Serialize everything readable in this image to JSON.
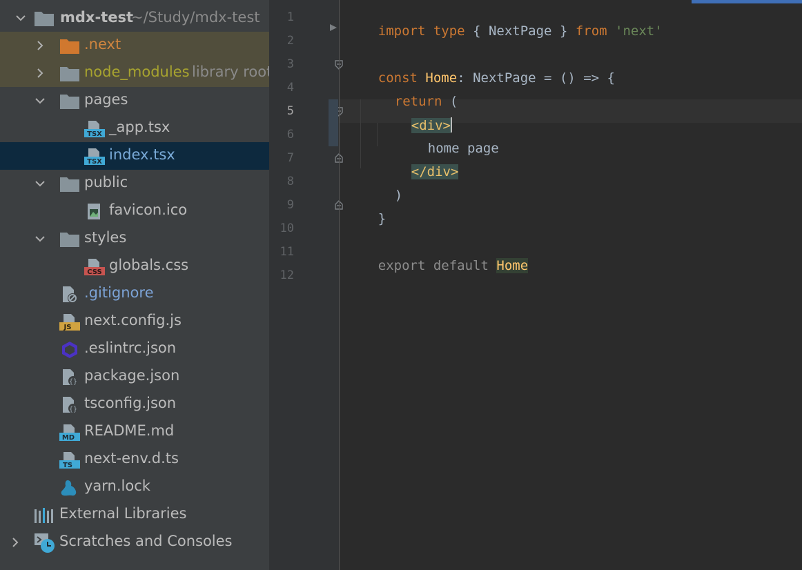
{
  "tree": {
    "root": {
      "name": "mdx-test",
      "path": "~/Study/mdx-test"
    },
    "items": [
      {
        "label": ".next",
        "icon": "folder-icon"
      },
      {
        "label": "node_modules",
        "hint": "library root",
        "icon": "folder-icon"
      },
      {
        "label": "pages",
        "icon": "folder-icon"
      },
      {
        "label": "_app.tsx",
        "icon": "tsx-file-icon",
        "badge": "TSX"
      },
      {
        "label": "index.tsx",
        "icon": "tsx-file-icon",
        "badge": "TSX"
      },
      {
        "label": "public",
        "icon": "folder-icon"
      },
      {
        "label": "favicon.ico",
        "icon": "image-file-icon"
      },
      {
        "label": "styles",
        "icon": "folder-icon"
      },
      {
        "label": "globals.css",
        "icon": "css-file-icon",
        "badge": "CSS"
      },
      {
        "label": ".gitignore",
        "icon": "ignore-file-icon"
      },
      {
        "label": "next.config.js",
        "icon": "js-file-icon",
        "badge": "JS"
      },
      {
        "label": ".eslintrc.json",
        "icon": "eslint-icon"
      },
      {
        "label": "package.json",
        "icon": "json-file-icon"
      },
      {
        "label": "tsconfig.json",
        "icon": "json-file-icon"
      },
      {
        "label": "README.md",
        "icon": "markdown-file-icon",
        "badge": "MD"
      },
      {
        "label": "next-env.d.ts",
        "icon": "ts-file-icon",
        "badge": "TS"
      },
      {
        "label": "yarn.lock",
        "icon": "yarn-icon"
      }
    ],
    "external": "External Libraries",
    "scratches": "Scratches and Consoles"
  },
  "editor": {
    "line_numbers": [
      "1",
      "2",
      "3",
      "4",
      "5",
      "6",
      "7",
      "8",
      "9",
      "10",
      "11",
      "12"
    ],
    "current_line": "5",
    "code": {
      "l1_import": "import",
      "l1_type": "type",
      "l1_brace": "{ NextPage }",
      "l1_from": "from",
      "l1_str": "'next'",
      "l3_const": "const",
      "l3_name": "Home",
      "l3_rest": ": NextPage = () => {",
      "l4_return": "return",
      "l4_paren": "(",
      "l5_tag": "<div>",
      "l6_text": "home page",
      "l7_tag": "</div>",
      "l8_paren": ")",
      "l9_brace": "}",
      "l11_export": "export default",
      "l11_name": "Home"
    }
  },
  "colors": {
    "tree_bg": "#3c3f41",
    "editor_bg": "#2b2b2b",
    "selection": "#0d293e",
    "excluded": "#514e3c",
    "keyword": "#cc7832",
    "string": "#6a8759",
    "function": "#ffc66d"
  }
}
